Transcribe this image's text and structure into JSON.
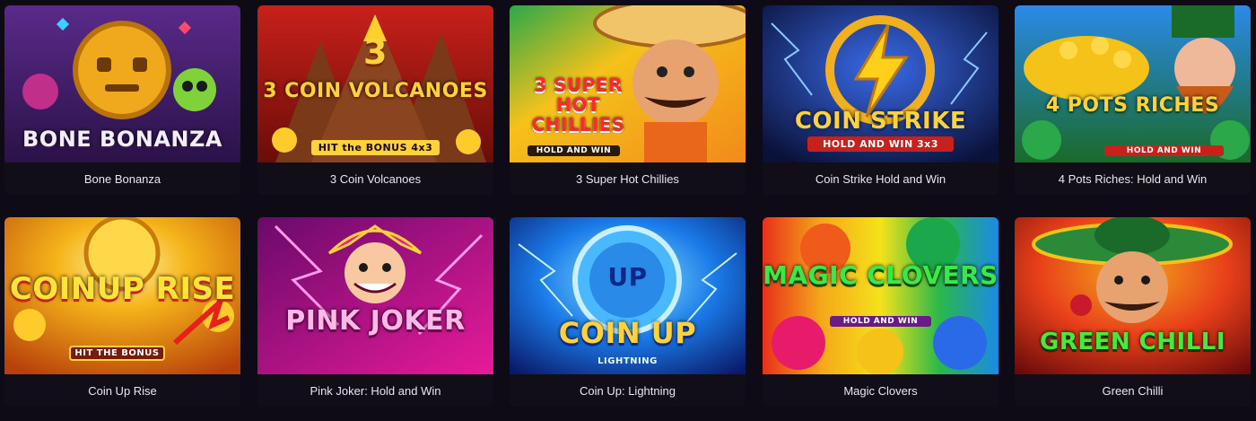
{
  "games": [
    {
      "title": "Bone Bonanza",
      "logo": "BONE BONANZA",
      "icon": "skull-icon"
    },
    {
      "title": "3 Coin Volcanoes",
      "logo": "3 COIN VOLCANOES",
      "badge": "HIT the BONUS 4x3",
      "icon": "volcano-icon"
    },
    {
      "title": "3 Super Hot Chillies",
      "logo": "3 SUPER HOT CHILLIES",
      "badge": "HOLD AND WIN",
      "icon": "chef-icon"
    },
    {
      "title": "Coin Strike Hold and Win",
      "logo": "COIN STRIKE",
      "badge": "HOLD AND WIN 3x3",
      "icon": "lightning-icon"
    },
    {
      "title": "4 Pots Riches: Hold and Win",
      "logo": "4 POTS RICHES",
      "badge": "HOLD AND WIN",
      "icon": "leprechaun-icon"
    },
    {
      "title": "Coin Up Rise",
      "logo": "COINUP RISE",
      "badge": "HIT THE BONUS",
      "icon": "coin-icon"
    },
    {
      "title": "Pink Joker: Hold and Win",
      "logo": "PINK JOKER",
      "icon": "joker-icon"
    },
    {
      "title": "Coin Up: Lightning",
      "logo": "COIN UP",
      "badge": "LIGHTNING",
      "icon": "coin-icon"
    },
    {
      "title": "Magic Clovers",
      "logo": "MAGIC CLOVERS",
      "badge": "HOLD AND WIN",
      "icon": "clover-icon"
    },
    {
      "title": "Green Chilli",
      "logo": "GREEN CHILLI",
      "icon": "sombrero-icon"
    }
  ]
}
